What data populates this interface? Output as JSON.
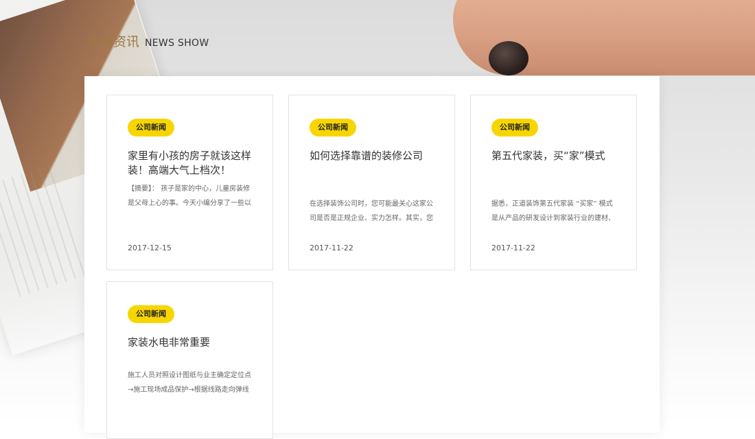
{
  "section": {
    "title_cn": "新闻资讯",
    "title_en": "NEWS SHOW"
  },
  "news": [
    {
      "category": "公司新闻",
      "title": "家里有小孩的房子就该这样装！高端大气上档次！",
      "summary": "【摘要】： 孩子是家的中心，儿童房装修是父母上心的事。今天小编分享了一些以",
      "date": "2017-12-15"
    },
    {
      "category": "公司新闻",
      "title": "如何选择靠谱的装修公司",
      "summary": "在选择装饰公司时，您可能最关心这家公司是否是正规企业、实力怎样。其实，您",
      "date": "2017-11-22"
    },
    {
      "category": "公司新闻",
      "title": "第五代家装，买“家”模式",
      "summary": "据悉，正道装饰第五代家装 “买家” 模式是从产品的研发设计到家装行业的建材、",
      "date": "2017-11-22"
    },
    {
      "category": "公司新闻",
      "title": "家装水电非常重要",
      "summary": "施工人员对照设计图纸与业主确定定位点→施工现场成品保护→根据线路走向弹线",
      "date": ""
    }
  ],
  "colors": {
    "badge_bg": "#f7d600",
    "heading_cn": "#9a7a44"
  }
}
